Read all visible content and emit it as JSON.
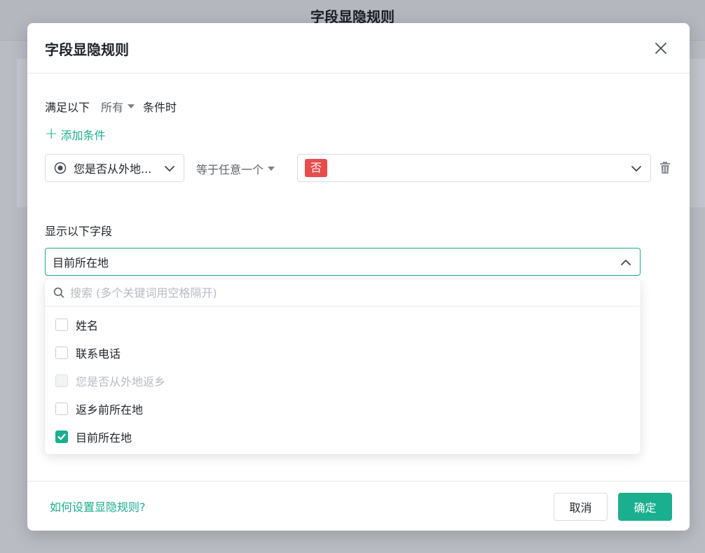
{
  "background": {
    "page_title": "字段显隐规则"
  },
  "modal": {
    "title": "字段显隐规则",
    "condition": {
      "prefix": "满足以下",
      "match_mode": "所有",
      "suffix": "条件时",
      "add_label": "添加条件",
      "field": "您是否从外地...",
      "operator": "等于任意一个",
      "value_tag": "否",
      "value_tag_color": "#e84c4c"
    },
    "show_fields": {
      "label": "显示以下字段",
      "selected": "目前所在地",
      "search_placeholder": "搜索 (多个关键词用空格隔开)",
      "options": [
        {
          "label": "姓名",
          "checked": false,
          "disabled": false
        },
        {
          "label": "联系电话",
          "checked": false,
          "disabled": false
        },
        {
          "label": "您是否从外地返乡",
          "checked": false,
          "disabled": true
        },
        {
          "label": "返乡前所在地",
          "checked": false,
          "disabled": false
        },
        {
          "label": "目前所在地",
          "checked": true,
          "disabled": false
        }
      ]
    },
    "footer": {
      "help_link": "如何设置显隐规则?",
      "cancel_label": "取消",
      "ok_label": "确定"
    },
    "accent_color": "#1aaf8e"
  }
}
